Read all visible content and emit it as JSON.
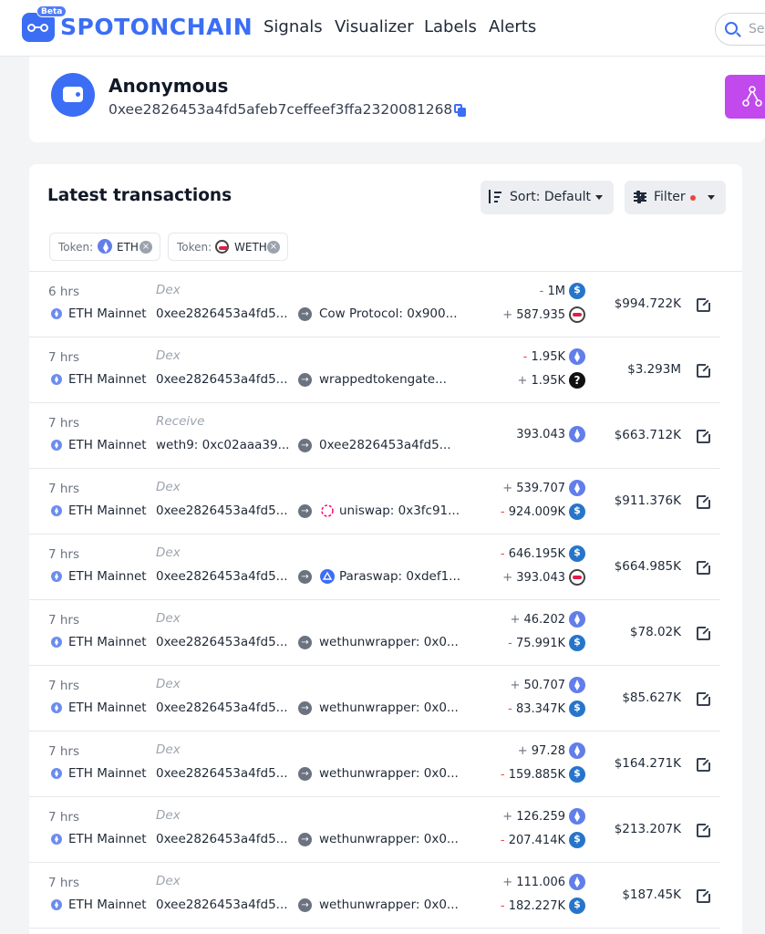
{
  "header": {
    "beta": "Beta",
    "brand": "SPOTONCHAIN",
    "nav": [
      "Signals",
      "Visualizer",
      "Labels",
      "Alerts"
    ],
    "search_placeholder": "Se"
  },
  "profile": {
    "name": "Anonymous",
    "address": "0xee2826453a4fd5afeb7ceffeef3ffa2320081268"
  },
  "transactions": {
    "title": "Latest transactions",
    "sort_label": "Sort: Default",
    "filter_label": "Filter",
    "filters": [
      {
        "key": "Token:",
        "value": "ETH",
        "icon": "eth-icon"
      },
      {
        "key": "Token:",
        "value": "WETH",
        "icon": "weth-icon"
      }
    ],
    "rows": [
      {
        "time": "6 hrs",
        "chain": "ETH Mainnet",
        "type": "Dex",
        "from": "0xee2826453a4fd5...",
        "to": "Cow Protocol: 0x900...",
        "to_icon": "",
        "amounts": [
          {
            "sign": "-",
            "value": "1M",
            "token": "usdc"
          },
          {
            "sign": "+",
            "value": "587.935",
            "token": "weth"
          }
        ],
        "usd": "$994.722K"
      },
      {
        "time": "7 hrs",
        "chain": "ETH Mainnet",
        "type": "Dex",
        "from": "0xee2826453a4fd5...",
        "to": "wrappedtokengate...",
        "to_icon": "",
        "amounts": [
          {
            "sign": "-",
            "value": "1.95K",
            "token": "eth"
          },
          {
            "sign": "+",
            "value": "1.95K",
            "token": "unknown"
          }
        ],
        "usd": "$3.293M"
      },
      {
        "time": "7 hrs",
        "chain": "ETH Mainnet",
        "type": "Receive",
        "from": "weth9: 0xc02aaa39...",
        "to": "0xee2826453a4fd5...",
        "to_icon": "",
        "amounts": [
          {
            "sign": "",
            "value": "393.043",
            "token": "eth"
          }
        ],
        "usd": "$663.712K"
      },
      {
        "time": "7 hrs",
        "chain": "ETH Mainnet",
        "type": "Dex",
        "from": "0xee2826453a4fd5...",
        "to": "uniswap: 0x3fc91...",
        "to_icon": "uniswap",
        "amounts": [
          {
            "sign": "+",
            "value": "539.707",
            "token": "eth"
          },
          {
            "sign": "-",
            "value": "924.009K",
            "token": "usdc"
          }
        ],
        "usd": "$911.376K"
      },
      {
        "time": "7 hrs",
        "chain": "ETH Mainnet",
        "type": "Dex",
        "from": "0xee2826453a4fd5...",
        "to": "Paraswap: 0xdef1...",
        "to_icon": "paraswap",
        "amounts": [
          {
            "sign": "-",
            "value": "646.195K",
            "token": "usdc"
          },
          {
            "sign": "+",
            "value": "393.043",
            "token": "weth"
          }
        ],
        "usd": "$664.985K"
      },
      {
        "time": "7 hrs",
        "chain": "ETH Mainnet",
        "type": "Dex",
        "from": "0xee2826453a4fd5...",
        "to": "wethunwrapper: 0x0...",
        "to_icon": "",
        "amounts": [
          {
            "sign": "+",
            "value": "46.202",
            "token": "eth"
          },
          {
            "sign": "-",
            "value": "75.991K",
            "token": "usdc"
          }
        ],
        "usd": "$78.02K"
      },
      {
        "time": "7 hrs",
        "chain": "ETH Mainnet",
        "type": "Dex",
        "from": "0xee2826453a4fd5...",
        "to": "wethunwrapper: 0x0...",
        "to_icon": "",
        "amounts": [
          {
            "sign": "+",
            "value": "50.707",
            "token": "eth"
          },
          {
            "sign": "-",
            "value": "83.347K",
            "token": "usdc"
          }
        ],
        "usd": "$85.627K"
      },
      {
        "time": "7 hrs",
        "chain": "ETH Mainnet",
        "type": "Dex",
        "from": "0xee2826453a4fd5...",
        "to": "wethunwrapper: 0x0...",
        "to_icon": "",
        "amounts": [
          {
            "sign": "+",
            "value": "97.28",
            "token": "eth"
          },
          {
            "sign": "-",
            "value": "159.885K",
            "token": "usdc"
          }
        ],
        "usd": "$164.271K"
      },
      {
        "time": "7 hrs",
        "chain": "ETH Mainnet",
        "type": "Dex",
        "from": "0xee2826453a4fd5...",
        "to": "wethunwrapper: 0x0...",
        "to_icon": "",
        "amounts": [
          {
            "sign": "+",
            "value": "126.259",
            "token": "eth"
          },
          {
            "sign": "-",
            "value": "207.414K",
            "token": "usdc"
          }
        ],
        "usd": "$213.207K"
      },
      {
        "time": "7 hrs",
        "chain": "ETH Mainnet",
        "type": "Dex",
        "from": "0xee2826453a4fd5...",
        "to": "wethunwrapper: 0x0...",
        "to_icon": "",
        "amounts": [
          {
            "sign": "+",
            "value": "111.006",
            "token": "eth"
          },
          {
            "sign": "-",
            "value": "182.227K",
            "token": "usdc"
          }
        ],
        "usd": "$187.45K"
      }
    ]
  },
  "colors": {
    "brand": "#3b6ef5",
    "graph_button": "#c249ec",
    "negative": "#ef4444"
  }
}
